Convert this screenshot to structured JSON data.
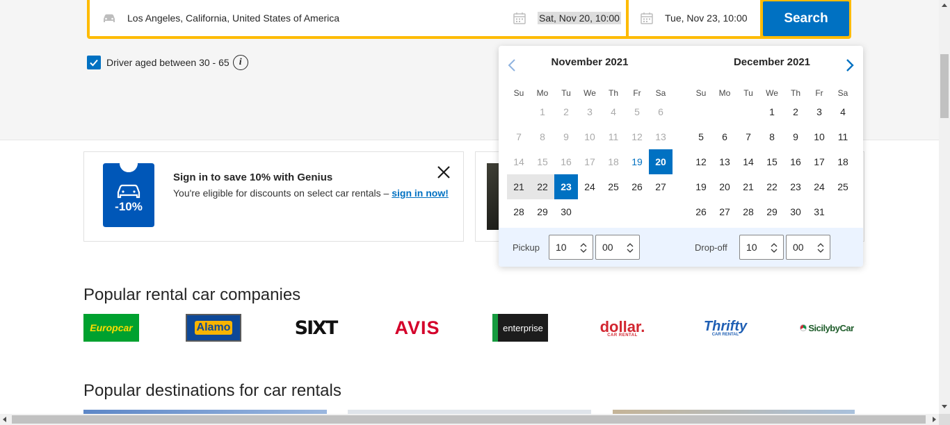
{
  "search": {
    "location": "Los Angeles, California, United States of America",
    "pickup_date": "Sat, Nov 20, 10:00",
    "dropoff_date": "Tue, Nov 23, 10:00",
    "button_label": "Search"
  },
  "driver": {
    "label": "Driver aged between 30 - 65",
    "checked": true,
    "info_glyph": "i"
  },
  "genius": {
    "badge": "-10%",
    "title": "Sign in to save 10% with Genius",
    "desc": "You're eligible for discounts on select car rentals – ",
    "link": "sign in now!"
  },
  "datepicker": {
    "months": [
      {
        "title": "November 2021",
        "weekdays": [
          "Su",
          "Mo",
          "Tu",
          "We",
          "Th",
          "Fr",
          "Sa"
        ],
        "days": [
          {
            "d": "",
            "s": "empty"
          },
          {
            "d": "1",
            "s": "past"
          },
          {
            "d": "2",
            "s": "past"
          },
          {
            "d": "3",
            "s": "past"
          },
          {
            "d": "4",
            "s": "past"
          },
          {
            "d": "5",
            "s": "past"
          },
          {
            "d": "6",
            "s": "past"
          },
          {
            "d": "7",
            "s": "past"
          },
          {
            "d": "8",
            "s": "past"
          },
          {
            "d": "9",
            "s": "past"
          },
          {
            "d": "10",
            "s": "past"
          },
          {
            "d": "11",
            "s": "past"
          },
          {
            "d": "12",
            "s": "past"
          },
          {
            "d": "13",
            "s": "past"
          },
          {
            "d": "14",
            "s": "past"
          },
          {
            "d": "15",
            "s": "past"
          },
          {
            "d": "16",
            "s": "past"
          },
          {
            "d": "17",
            "s": "past"
          },
          {
            "d": "18",
            "s": "past"
          },
          {
            "d": "19",
            "s": "today"
          },
          {
            "d": "20",
            "s": "sel"
          },
          {
            "d": "21",
            "s": "range"
          },
          {
            "d": "22",
            "s": "range"
          },
          {
            "d": "23",
            "s": "sel"
          },
          {
            "d": "24",
            "s": ""
          },
          {
            "d": "25",
            "s": ""
          },
          {
            "d": "26",
            "s": ""
          },
          {
            "d": "27",
            "s": ""
          },
          {
            "d": "28",
            "s": ""
          },
          {
            "d": "29",
            "s": ""
          },
          {
            "d": "30",
            "s": ""
          }
        ]
      },
      {
        "title": "December 2021",
        "weekdays": [
          "Su",
          "Mo",
          "Tu",
          "We",
          "Th",
          "Fr",
          "Sa"
        ],
        "days": [
          {
            "d": "",
            "s": "empty"
          },
          {
            "d": "",
            "s": "empty"
          },
          {
            "d": "",
            "s": "empty"
          },
          {
            "d": "1",
            "s": ""
          },
          {
            "d": "2",
            "s": ""
          },
          {
            "d": "3",
            "s": ""
          },
          {
            "d": "4",
            "s": ""
          },
          {
            "d": "5",
            "s": ""
          },
          {
            "d": "6",
            "s": ""
          },
          {
            "d": "7",
            "s": ""
          },
          {
            "d": "8",
            "s": ""
          },
          {
            "d": "9",
            "s": ""
          },
          {
            "d": "10",
            "s": ""
          },
          {
            "d": "11",
            "s": ""
          },
          {
            "d": "12",
            "s": ""
          },
          {
            "d": "13",
            "s": ""
          },
          {
            "d": "14",
            "s": ""
          },
          {
            "d": "15",
            "s": ""
          },
          {
            "d": "16",
            "s": ""
          },
          {
            "d": "17",
            "s": ""
          },
          {
            "d": "18",
            "s": ""
          },
          {
            "d": "19",
            "s": ""
          },
          {
            "d": "20",
            "s": ""
          },
          {
            "d": "21",
            "s": ""
          },
          {
            "d": "22",
            "s": ""
          },
          {
            "d": "23",
            "s": ""
          },
          {
            "d": "24",
            "s": ""
          },
          {
            "d": "25",
            "s": ""
          },
          {
            "d": "26",
            "s": ""
          },
          {
            "d": "27",
            "s": ""
          },
          {
            "d": "28",
            "s": ""
          },
          {
            "d": "29",
            "s": ""
          },
          {
            "d": "30",
            "s": ""
          },
          {
            "d": "31",
            "s": ""
          }
        ]
      }
    ],
    "pickup_label": "Pickup",
    "pickup_hour": "10",
    "pickup_minute": "00",
    "dropoff_label": "Drop-off",
    "dropoff_hour": "10",
    "dropoff_minute": "00"
  },
  "sections": {
    "companies_title": "Popular rental car companies",
    "destinations_title": "Popular destinations for car rentals"
  },
  "companies": {
    "europcar": "Europcar",
    "alamo": "Alamo",
    "sixt": "SIXT",
    "avis": "AVIS",
    "enterprise": "enterprise",
    "dollar": "dollar.",
    "dollar_sub": "CAR RENTAL",
    "thrifty": "Thrifty",
    "thrifty_sub": "CAR RENTAL",
    "sicily": "SicilybyCar"
  },
  "colors": {
    "accent": "#0071c2",
    "search_border": "#febb02"
  }
}
